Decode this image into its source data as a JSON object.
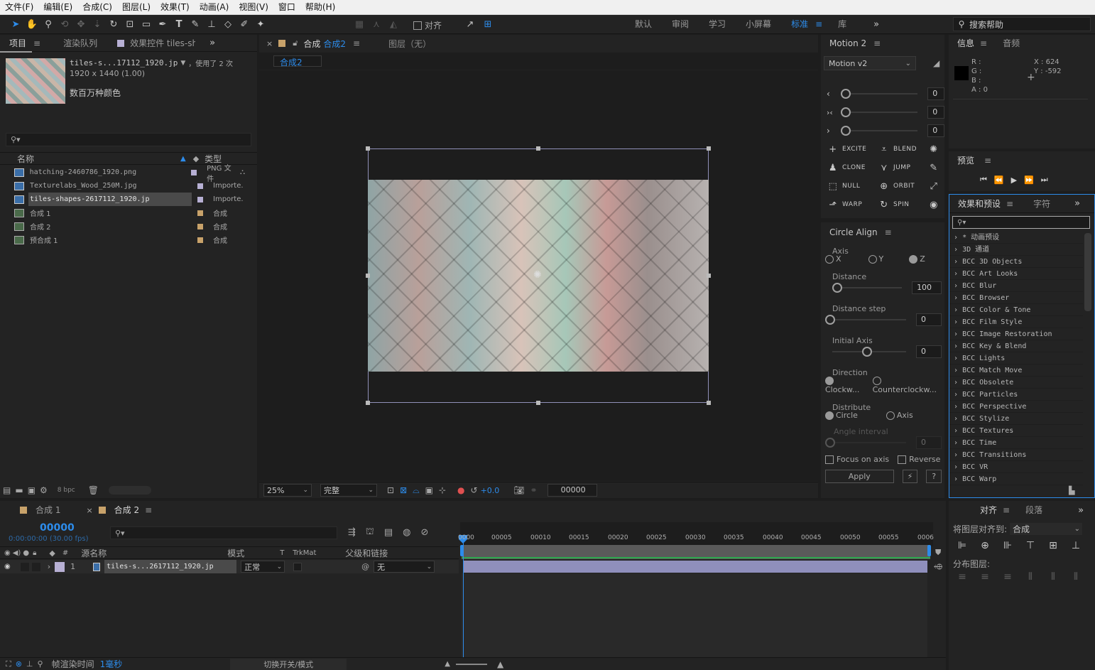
{
  "menu": [
    "文件(F)",
    "编辑(E)",
    "合成(C)",
    "图层(L)",
    "效果(T)",
    "动画(A)",
    "视图(V)",
    "窗口",
    "帮助(H)"
  ],
  "toolbar": {
    "align_label": "对齐",
    "workspaces": [
      "默认",
      "审阅",
      "学习",
      "小屏幕",
      "标准",
      "库"
    ],
    "active_workspace": "标准",
    "search_help_placeholder": "搜索帮助"
  },
  "project": {
    "tabs": [
      "项目",
      "渲染队列",
      "效果控件 tiles-sha"
    ],
    "preview_name": "tiles-s...17112_1920.jp",
    "preview_used": "，使用了 2 次",
    "preview_size": "1920 x 1440 (1.00)",
    "preview_colors": "数百万种颜色",
    "col_name": "名称",
    "col_type": "类型",
    "files": [
      {
        "name": "hatching-2460786_1920.png",
        "type": "PNG 文件",
        "color": "#b7b0d4",
        "kind": "img"
      },
      {
        "name": "Texturelabs_Wood_250M.jpg",
        "type": "Importe.",
        "color": "#b7b0d4",
        "kind": "img"
      },
      {
        "name": "tiles-shapes-2617112_1920.jp",
        "type": "Importe.",
        "color": "#b7b0d4",
        "kind": "img",
        "selected": true
      },
      {
        "name": "合成 1",
        "type": "合成",
        "color": "#c8a26a",
        "kind": "comp"
      },
      {
        "name": "合成 2",
        "type": "合成",
        "color": "#c8a26a",
        "kind": "comp"
      },
      {
        "name": "预合成 1",
        "type": "合成",
        "color": "#c8a26a",
        "kind": "comp"
      }
    ],
    "bpc": "8 bpc"
  },
  "comp": {
    "tab_label": "合成",
    "tab_comp": "合成2",
    "layer_tab": "图层（无）",
    "breadcrumb": "合成2",
    "zoom": "25%",
    "quality": "完整",
    "exposure": "+0.0",
    "timecode": "00000"
  },
  "motion": {
    "title": "Motion 2",
    "preset": "Motion v2",
    "sliders": [
      {
        "icon": "‹",
        "value": "0"
      },
      {
        "icon": "›‹",
        "value": "0"
      },
      {
        "icon": "›",
        "value": "0"
      }
    ],
    "buttons": [
      [
        "EXCITE",
        "BLEND",
        ""
      ],
      [
        "CLONE",
        "JUMP",
        ""
      ],
      [
        "NULL",
        "ORBIT",
        ""
      ],
      [
        "WARP",
        "SPIN",
        ""
      ]
    ]
  },
  "circle_align": {
    "title": "Circle Align",
    "axis_label": "Axis",
    "axis_options": [
      "X",
      "Y",
      "Z"
    ],
    "distance_label": "Distance",
    "distance_value": "100",
    "distance_step_label": "Distance step",
    "distance_step_value": "0",
    "initial_axis_label": "Initial Axis",
    "initial_axis_value": "0",
    "direction_label": "Direction",
    "direction_options": [
      "Clockw...",
      "Counterclockw..."
    ],
    "distribute_label": "Distribute",
    "distribute_options": [
      "Circle",
      "Axis"
    ],
    "angle_label": "Angle interval",
    "angle_value": "0",
    "focus_label": "Focus on axis",
    "reverse_label": "Reverse",
    "apply_label": "Apply",
    "help_label": "?"
  },
  "info": {
    "tabs": [
      "信息",
      "音频"
    ],
    "r": "R :",
    "g": "G :",
    "b": "B :",
    "a": "A : 0",
    "x": "X : 624",
    "y": "Y : -592"
  },
  "preview": {
    "title": "预览"
  },
  "effects": {
    "tabs": [
      "效果和预设",
      "字符"
    ],
    "items": [
      "* 动画预设",
      "3D 通道",
      "BCC 3D Objects",
      "BCC Art Looks",
      "BCC Blur",
      "BCC Browser",
      "BCC Color & Tone",
      "BCC Film Style",
      "BCC Image Restoration",
      "BCC Key & Blend",
      "BCC Lights",
      "BCC Match Move",
      "BCC Obsolete",
      "BCC Particles",
      "BCC Perspective",
      "BCC Stylize",
      "BCC Textures",
      "BCC Time",
      "BCC Transitions",
      "BCC VR",
      "BCC Warp"
    ]
  },
  "align": {
    "tabs": [
      "对齐",
      "段落"
    ],
    "align_to_label": "将图层对齐到:",
    "align_to_value": "合成",
    "distribute_label": "分布图层:"
  },
  "timeline": {
    "tabs": [
      "合成 1",
      "合成 2"
    ],
    "timecode": "00000",
    "fps": "0:00:00:00 (30.00 fps)",
    "headers": {
      "source": "源名称",
      "mode": "模式",
      "t": "T",
      "trkmat": "TrkMat",
      "parent": "父级和链接"
    },
    "layer": {
      "num": "1",
      "name": "tiles-s...2617112_1920.jp",
      "mode": "正常",
      "parent": "无"
    },
    "ticks": [
      "0000",
      "00005",
      "00010",
      "00015",
      "00020",
      "00025",
      "00030",
      "00035",
      "00040",
      "00045",
      "00050",
      "00055",
      "0006"
    ],
    "render_label": "帧渲染时间",
    "render_value": "1毫秒",
    "switch_label": "切换开关/模式"
  }
}
